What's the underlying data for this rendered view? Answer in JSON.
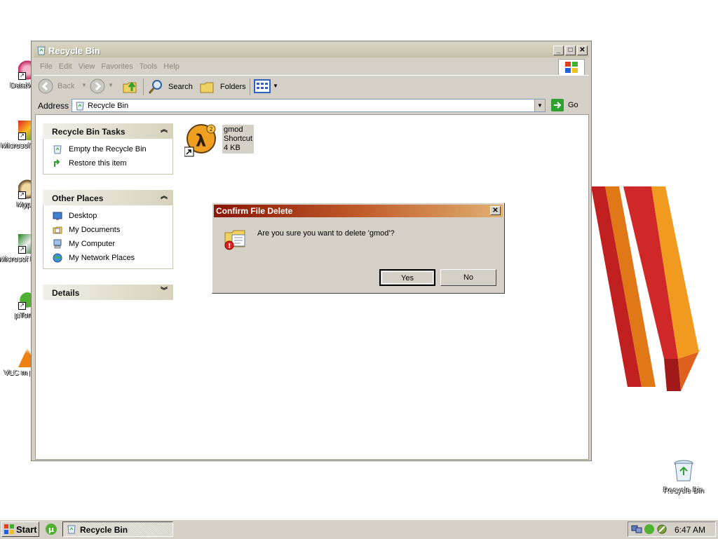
{
  "desktop": {
    "icons": [
      {
        "label": "DataWa",
        "icon": "flower-icon"
      },
      {
        "label": "Microsof C++",
        "icon": "visual-cpp-icon"
      },
      {
        "label": "Myp",
        "icon": "character-icon"
      },
      {
        "label": "Microsof Basic",
        "icon": "visual-basic-icon"
      },
      {
        "label": "µTorr",
        "icon": "utorrent-icon"
      },
      {
        "label": "VLC m play",
        "icon": "vlc-icon"
      }
    ],
    "recycle_bin_label": "Recycle Bin"
  },
  "window": {
    "title": "Recycle Bin",
    "menu": [
      "File",
      "Edit",
      "View",
      "Favorites",
      "Tools",
      "Help"
    ],
    "toolbar": {
      "back": "Back",
      "search": "Search",
      "folders": "Folders"
    },
    "address": {
      "label": "Address",
      "value": "Recycle Bin",
      "go": "Go"
    },
    "tasks_panel": {
      "title": "Recycle Bin Tasks",
      "items": [
        "Empty the Recycle Bin",
        "Restore this item"
      ]
    },
    "places_panel": {
      "title": "Other Places",
      "items": [
        "Desktop",
        "My Documents",
        "My Computer",
        "My Network Places"
      ]
    },
    "details_panel": {
      "title": "Details"
    },
    "file": {
      "name": "gmod",
      "type": "Shortcut",
      "size": "4 KB"
    }
  },
  "dialog": {
    "title": "Confirm File Delete",
    "message": "Are you sure you want to delete 'gmod'?",
    "yes": "Yes",
    "no": "No"
  },
  "taskbar": {
    "start": "Start",
    "task": "Recycle Bin",
    "clock": "6:47 AM"
  },
  "colors": {
    "dialog_title": "#8a1606",
    "window_bg": "#d4d0c8"
  }
}
